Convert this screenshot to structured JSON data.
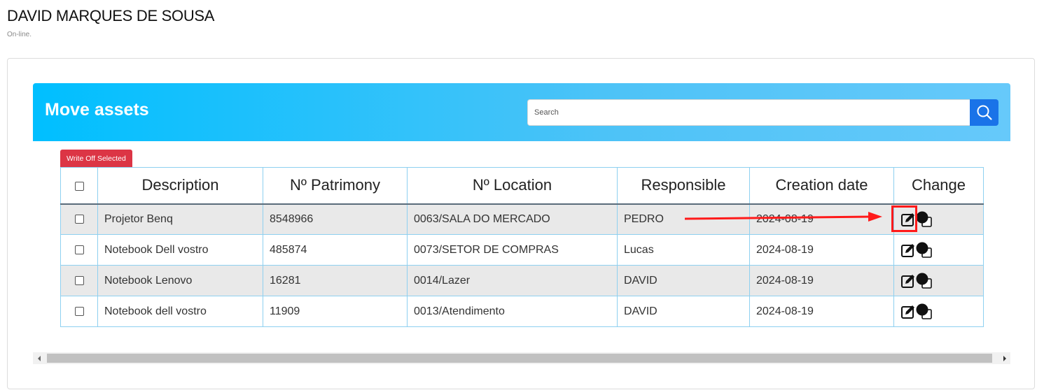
{
  "header": {
    "user_name": "DAVID MARQUES DE SOUSA",
    "status": "On-line."
  },
  "panel": {
    "title": "Move assets",
    "search": {
      "placeholder": "Search",
      "value": ""
    },
    "write_off_label": "Write Off Selected"
  },
  "table": {
    "columns": [
      "Description",
      "Nº Patrimony",
      "Nº Location",
      "Responsible",
      "Creation date",
      "Change"
    ],
    "rows": [
      [
        "Projetor Benq",
        "8548966",
        "0063/SALA DO MERCADO",
        "PEDRO",
        "2024-08-19"
      ],
      [
        "Notebook Dell vostro",
        "485874",
        "0073/SETOR DE COMPRAS",
        "Lucas",
        "2024-08-19"
      ],
      [
        "Notebook Lenovo",
        "16281",
        "0014/Lazer",
        "DAVID",
        "2024-08-19"
      ],
      [
        "Notebook dell vostro",
        "11909",
        "0013/Atendimento",
        "DAVID",
        "2024-08-19"
      ]
    ]
  },
  "icons": {
    "search": "search-icon",
    "edit": "edit-icon",
    "duplicate": "duplicate-icon",
    "scroll_left": "chevron-left-icon",
    "scroll_right": "chevron-right-icon"
  },
  "colors": {
    "banner_start": "#00bfff",
    "banner_end": "#66c9fa",
    "search_button": "#1a73e8",
    "write_off_button": "#dc3545",
    "annotation": "#ff1a1a"
  }
}
